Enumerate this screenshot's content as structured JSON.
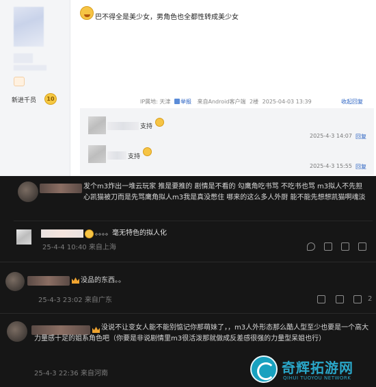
{
  "top": {
    "user": {
      "rank_label": "新进千员",
      "rank_level": "10"
    },
    "post": {
      "content": "巴不得全是美少女，男角色也全都性转成美少女",
      "meta": {
        "ip": "IP属地: 天津",
        "report": "举报",
        "source": "来自Android客户端",
        "floor": "2楼",
        "time": "2025-04-03 13:39",
        "collapse": "收起回复"
      }
    },
    "replies": [
      {
        "text": "支持",
        "time": "2025-4-3 14:07",
        "action": "回复"
      },
      {
        "text": "支持",
        "time": "2025-4-3 15:55",
        "action": "回复"
      }
    ]
  },
  "comments": [
    {
      "text": "发个m3炸出一堆云玩家 推是要推的 剧情是不看的 勾鹰角吃书骂 不吃书也骂 m3拟人不先担心凯猫被刀而是先骂鹰角拟人m3我是真没憋住 哪来的这么多人外厨 能不能先想想凯猫啊魂淡",
      "sub_reply": {
        "text": "。。。。毫无特色的拟人化",
        "time": "25-4-4 10:40",
        "location": "来自上海"
      }
    },
    {
      "text": "没品的东西。。",
      "time": "25-4-3 23:02",
      "location": "来自广东",
      "like_count": "2"
    },
    {
      "text": "没说不让变女人能不能别惦记你那萌妹了，，m3人外形态那么酷人型至少也要是一个高大力量感十足的姐系角色吧（你要是非说剧情里m3很活泼那就做成反差感很强的力量型呆姐也行）",
      "time": "25-4-3 22:36",
      "location": "来自河南"
    }
  ],
  "watermark": {
    "title": "奇辉拓游网",
    "subtitle": "QIHUI TUOYOU NETWORK"
  },
  "colors": {
    "dark_bg": "#161616",
    "link_blue": "#2b63c3",
    "vip_orange": "#f0a430",
    "watermark_teal": "#2aa6c8"
  }
}
